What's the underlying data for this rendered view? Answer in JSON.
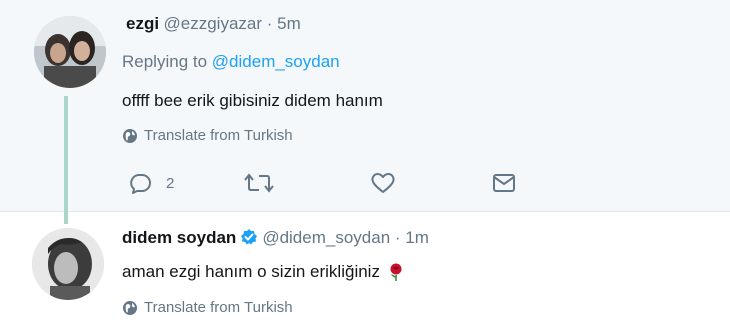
{
  "reply_tweet": {
    "name": "ezgi",
    "handle": "@ezzgiyazar",
    "separator": " · ",
    "time": "5m",
    "replying_label": "Replying to",
    "replying_handle": "@didem_soydan",
    "text": "offff bee erik gibisiniz didem hanım",
    "translate": "Translate from Turkish",
    "reply_count": "2",
    "icons": [
      "reply-icon",
      "retweet-icon",
      "like-icon",
      "message-icon",
      "globe-icon"
    ]
  },
  "main_tweet": {
    "name": "didem soydan",
    "handle": "@didem_soydan",
    "separator": " · ",
    "time": "1m",
    "text": "aman ezgi hanım o sizin erikliğiniz",
    "emoji": "🌹",
    "translate": "Translate from Turkish",
    "icons": [
      "verified-badge-icon",
      "rose-emoji-icon",
      "globe-icon"
    ]
  },
  "colors": {
    "link": "#1da1f2",
    "muted": "#657786",
    "thread_line": "#a9d6c8",
    "background_top": "#f5f8fa"
  }
}
